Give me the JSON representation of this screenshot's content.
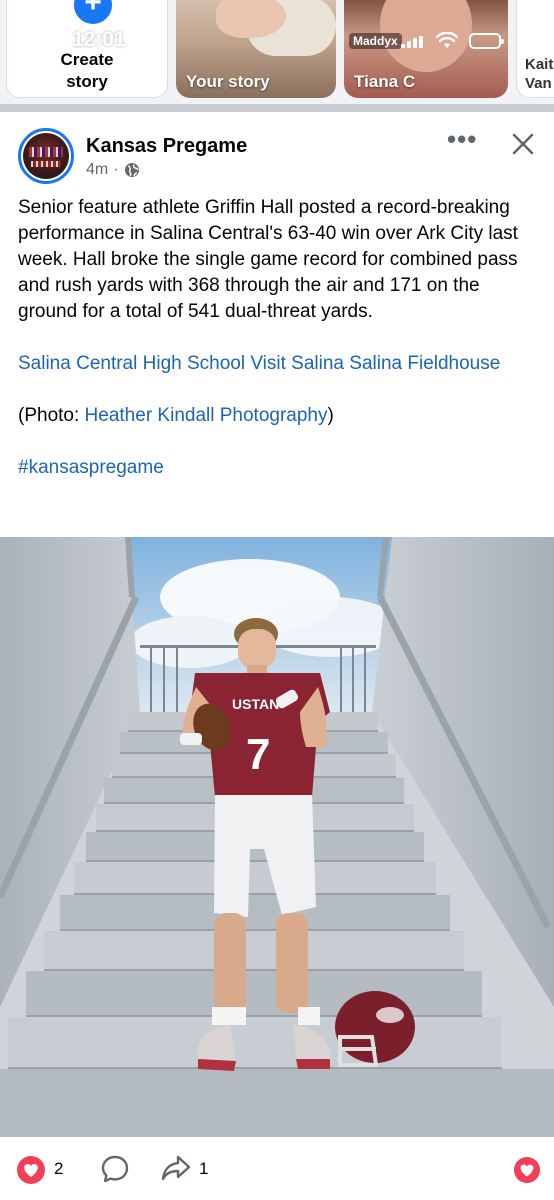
{
  "status_bar": {
    "time": "12:01",
    "carrier": "Maddyx"
  },
  "stories": {
    "create_label": "Create story",
    "items": [
      {
        "label": "Your story"
      },
      {
        "label": "Tiana C"
      },
      {
        "label": "Kait Van"
      }
    ]
  },
  "post": {
    "page_name": "Kansas Pregame",
    "time_ago": "4m",
    "separator": "·",
    "text": "Senior feature athlete Griffin Hall posted a record-breaking performance in Salina Central's 63-40 win over Ark City last week. Hall broke the single game record for combined pass and rush yards with 368 through the air and 171 on the ground for a total of 541 dual-threat yards.",
    "tags_line": "Salina Central High School Visit Salina Salina Fieldhouse",
    "photo_credit_prefix": "(Photo: ",
    "photo_credit_link": "Heather Kindall Photography",
    "photo_credit_suffix": ")",
    "hashtag": "#kansaspregame",
    "photo": {
      "jersey_text": "USTAN",
      "jersey_number": "7"
    }
  },
  "actions": {
    "reaction_count": "2",
    "share_count": "1"
  },
  "colors": {
    "accent": "#1877f2",
    "link": "#1b64b8",
    "love": "#f33e58",
    "jersey": "#8a2433"
  }
}
